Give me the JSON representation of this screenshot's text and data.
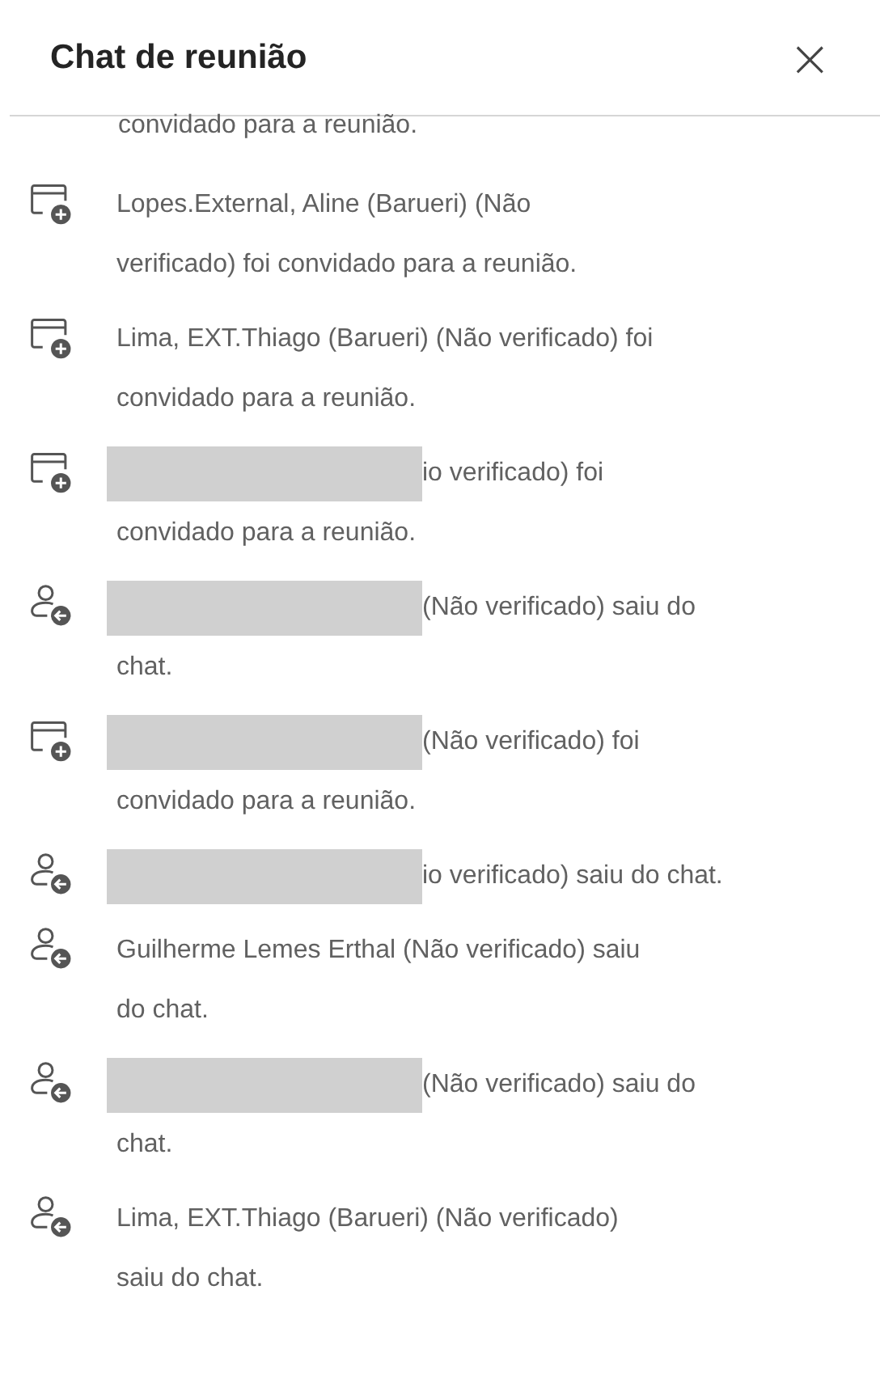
{
  "panel": {
    "title": "Chat de reunião",
    "close": "×"
  },
  "top_fragment": "convidado para a reunião.",
  "messages": [
    {
      "kind": "invited",
      "redacted": false,
      "lines": [
        "Lopes.External, Aline (Barueri) (Não",
        "verificado) foi convidado para a reunião."
      ]
    },
    {
      "kind": "invited",
      "redacted": false,
      "lines": [
        "Lima, EXT.Thiago (Barueri) (Não verificado) foi",
        "convidado para a reunião."
      ]
    },
    {
      "kind": "invited",
      "redacted": true,
      "lines": [
        "io verificado) foi",
        "convidado para a reunião."
      ]
    },
    {
      "kind": "left",
      "redacted": true,
      "lines": [
        "(Não verificado) saiu do",
        "chat."
      ]
    },
    {
      "kind": "invited",
      "redacted": true,
      "lines": [
        "(Não verificado) foi",
        "convidado para a reunião."
      ]
    },
    {
      "kind": "left",
      "redacted": true,
      "lines": [
        "io verificado) saiu do chat."
      ]
    },
    {
      "kind": "left",
      "redacted": false,
      "lines": [
        "Guilherme Lemes Erthal (Não verificado) saiu",
        "do chat."
      ]
    },
    {
      "kind": "left",
      "redacted": true,
      "lines": [
        "(Não verificado) saiu do",
        "chat."
      ]
    },
    {
      "kind": "left",
      "redacted": false,
      "lines": [
        "Lima, EXT.Thiago (Barueri) (Não verificado)",
        "saiu do chat."
      ]
    }
  ]
}
